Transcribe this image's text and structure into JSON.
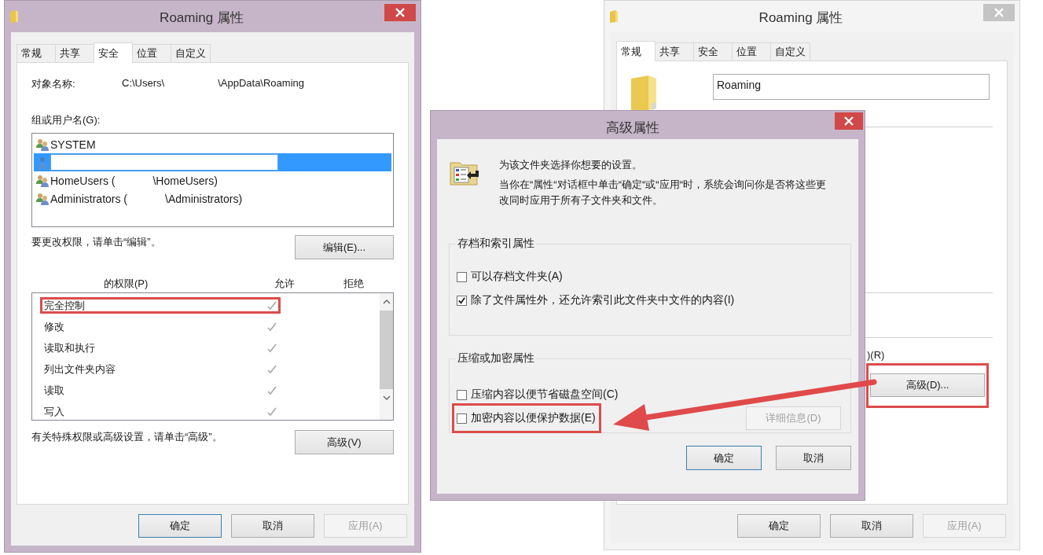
{
  "security_window": {
    "title": "Roaming 属性",
    "tabs": [
      {
        "label": "常规",
        "selected": false
      },
      {
        "label": "共享",
        "selected": false
      },
      {
        "label": "安全",
        "selected": true
      },
      {
        "label": "位置",
        "selected": false
      },
      {
        "label": "自定义",
        "selected": false
      }
    ],
    "object_name": {
      "label": "对象名称:",
      "path_start": "C:\\Users\\",
      "path_end": "\\AppData\\Roaming"
    },
    "users": {
      "label": "组或用户名(G):",
      "items": [
        {
          "kind": "group",
          "parts": [
            "SYSTEM"
          ],
          "selected": false
        },
        {
          "kind": "user",
          "selected": true
        },
        {
          "kind": "group",
          "parts": [
            "HomeUsers (",
            "\\HomeUsers)"
          ],
          "selected": false
        },
        {
          "kind": "group",
          "parts": [
            "Administrators (",
            "\\Administrators)"
          ],
          "selected": false
        }
      ]
    },
    "edit_hint": "要更改权限，请单击“编辑”。",
    "edit_button": "编辑(E)...",
    "permissions": {
      "label": "的权限(P)",
      "allow_header": "允许",
      "deny_header": "拒绝",
      "rows": [
        {
          "name": "完全控制",
          "allow": true,
          "highlighted": true
        },
        {
          "name": "修改",
          "allow": true,
          "highlighted": false
        },
        {
          "name": "读取和执行",
          "allow": true,
          "highlighted": false
        },
        {
          "name": "列出文件夹内容",
          "allow": true,
          "highlighted": false
        },
        {
          "name": "读取",
          "allow": true,
          "highlighted": false
        },
        {
          "name": "写入",
          "allow": true,
          "highlighted": false
        }
      ]
    },
    "advanced_hint": "有关特殊权限或高级设置，请单击“高级”。",
    "advanced_button": "高级(V)",
    "buttons": [
      {
        "label": "确定",
        "kind": "default",
        "disabled": false
      },
      {
        "label": "取消",
        "kind": "normal",
        "disabled": false
      },
      {
        "label": "应用(A)",
        "kind": "normal",
        "disabled": true
      }
    ]
  },
  "general_window": {
    "title": "Roaming 属性",
    "tabs": [
      {
        "label": "常规",
        "selected": true
      },
      {
        "label": "共享",
        "selected": false
      },
      {
        "label": "安全",
        "selected": false
      },
      {
        "label": "位置",
        "selected": false
      },
      {
        "label": "自定义",
        "selected": false
      }
    ],
    "name_value": "Roaming",
    "attributes_label": ")(R)",
    "advanced_button": {
      "label": "高级(D)...",
      "highlighted": true
    },
    "buttons": [
      {
        "label": "确定",
        "disabled": false
      },
      {
        "label": "取消",
        "disabled": false
      },
      {
        "label": "应用(A)",
        "disabled": true
      }
    ]
  },
  "advanced_dialog": {
    "title": "高级属性",
    "intro": "为该文件夹选择你想要的设置。",
    "note": "当你在“属性“对话框中单击“确定“或“应用“时，系统会询问你是否将这些更改同时应用于所有子文件夹和文件。",
    "groups": [
      {
        "title": "存档和索引属性",
        "options": [
          {
            "label": "可以存档文件夹(A)",
            "checked": false,
            "highlighted": false
          },
          {
            "label": "除了文件属性外，还允许索引此文件夹中文件的内容(I)",
            "checked": true,
            "highlighted": false
          }
        ]
      },
      {
        "title": "压缩或加密属性",
        "options": [
          {
            "label": "压缩内容以便节省磁盘空间(C)",
            "checked": false,
            "highlighted": false
          },
          {
            "label": "加密内容以便保护数据(E)",
            "checked": false,
            "highlighted": true
          }
        ],
        "details_button": {
          "label": "详细信息(D)",
          "disabled": true
        }
      }
    ],
    "buttons": [
      {
        "label": "确定",
        "kind": "default",
        "disabled": false
      },
      {
        "label": "取消",
        "kind": "normal",
        "disabled": false
      }
    ]
  }
}
